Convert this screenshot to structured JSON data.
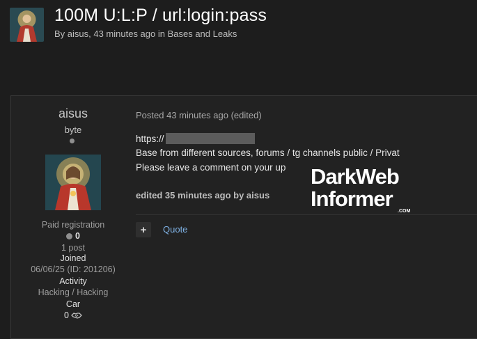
{
  "topic": {
    "title": "100M U:L:P / url:login:pass",
    "meta": "By aisus, 43 minutes ago in Bases and Leaks"
  },
  "author": {
    "name": "aisus",
    "title": "byte",
    "group": "Paid registration",
    "reputation": "0",
    "posts": "1 post",
    "joined_label": "Joined",
    "joined_value": "06/06/25 (ID: 201206)",
    "activity_label": "Activity",
    "activity_value": "Hacking / Hacking",
    "car_label": "Car",
    "car_value": "0"
  },
  "post": {
    "posted": "Posted 43 minutes ago (edited)",
    "url_prefix": "https://",
    "line2": "Base from different sources, forums / tg channels public / Privat",
    "line3": "Please leave a comment on your up",
    "edited": "edited 35 minutes ago by aisus",
    "quote_label": "Quote",
    "plus_label": "+"
  },
  "watermark": {
    "line1": "DarkWeb",
    "line2": "Informer",
    "suffix": ".COM"
  },
  "colors": {
    "background": "#1d1d1d",
    "panel": "#222222",
    "link": "#7fb2e5"
  }
}
